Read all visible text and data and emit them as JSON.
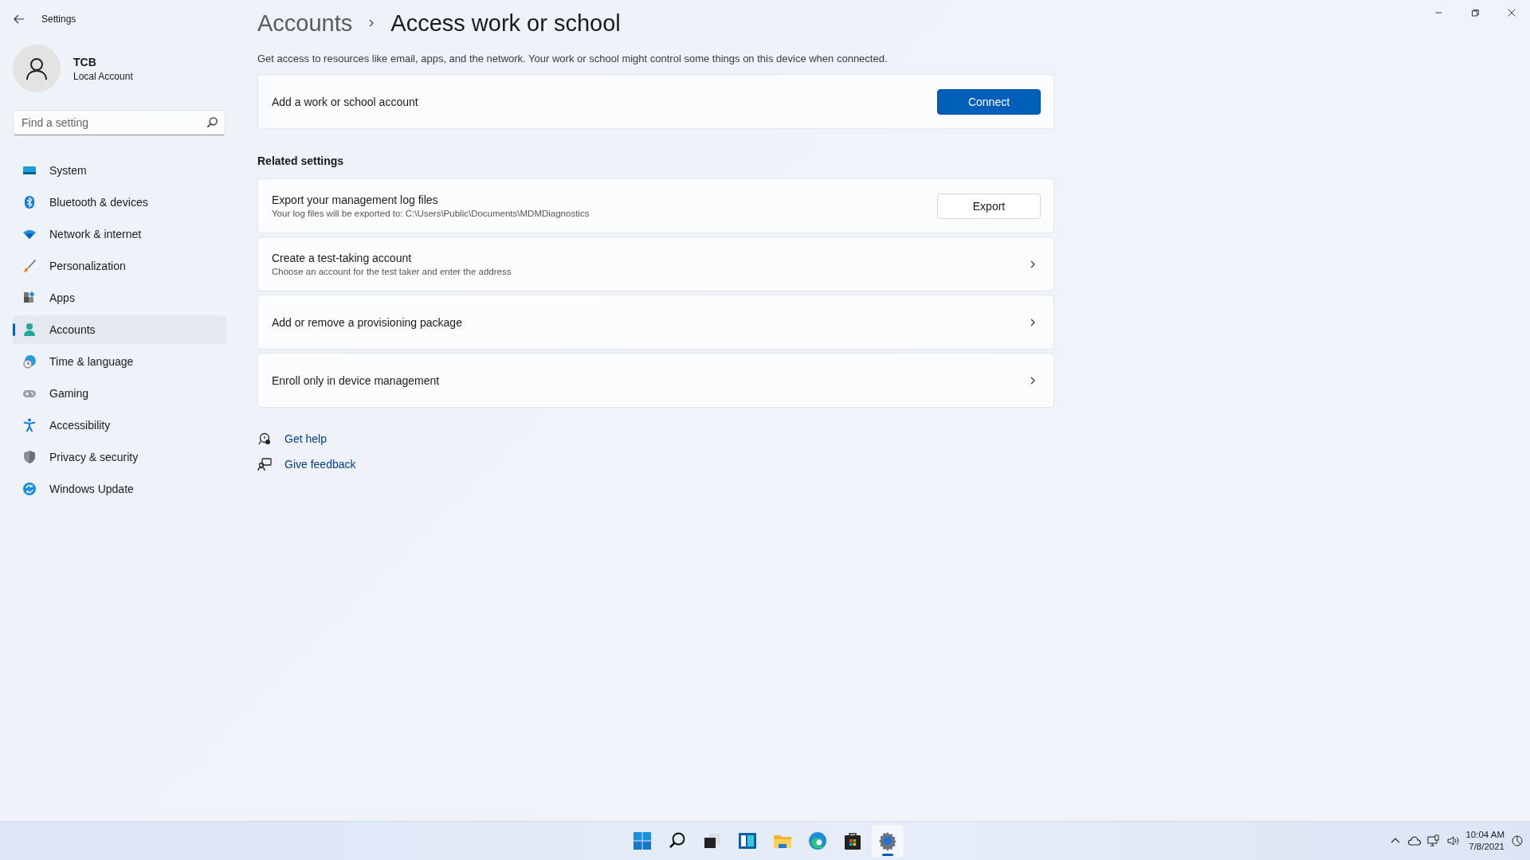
{
  "window": {
    "title": "Settings"
  },
  "user": {
    "name": "TCB",
    "account_type": "Local Account"
  },
  "search": {
    "placeholder": "Find a setting"
  },
  "nav": [
    {
      "label": "System",
      "selected": false
    },
    {
      "label": "Bluetooth & devices",
      "selected": false
    },
    {
      "label": "Network & internet",
      "selected": false
    },
    {
      "label": "Personalization",
      "selected": false
    },
    {
      "label": "Apps",
      "selected": false
    },
    {
      "label": "Accounts",
      "selected": true
    },
    {
      "label": "Time & language",
      "selected": false
    },
    {
      "label": "Gaming",
      "selected": false
    },
    {
      "label": "Accessibility",
      "selected": false
    },
    {
      "label": "Privacy & security",
      "selected": false
    },
    {
      "label": "Windows Update",
      "selected": false
    }
  ],
  "breadcrumb": {
    "parent": "Accounts",
    "current": "Access work or school"
  },
  "description": "Get access to resources like email, apps, and the network. Your work or school might control some things on this device when connected.",
  "account_card": {
    "label": "Add a work or school account",
    "button": "Connect"
  },
  "related": {
    "heading": "Related settings",
    "items": [
      {
        "kind": "button",
        "title": "Export your management log files",
        "subtitle": "Your log files will be exported to: C:\\Users\\Public\\Documents\\MDMDiagnostics",
        "button": "Export"
      },
      {
        "kind": "link",
        "title": "Create a test-taking account",
        "subtitle": "Choose an account for the test taker and enter the address"
      },
      {
        "kind": "link",
        "title": "Add or remove a provisioning package"
      },
      {
        "kind": "link",
        "title": "Enroll only in device management"
      }
    ]
  },
  "help_links": [
    "Get help",
    "Give feedback"
  ],
  "taskbar": {
    "apps": [
      {
        "selected": false
      },
      {
        "selected": false
      },
      {
        "selected": false
      },
      {
        "selected": false
      },
      {
        "selected": false
      },
      {
        "selected": false
      },
      {
        "selected": false
      },
      {
        "selected": true
      }
    ],
    "clock": {
      "time": "10:04 AM",
      "date": "7/8/2021"
    }
  }
}
